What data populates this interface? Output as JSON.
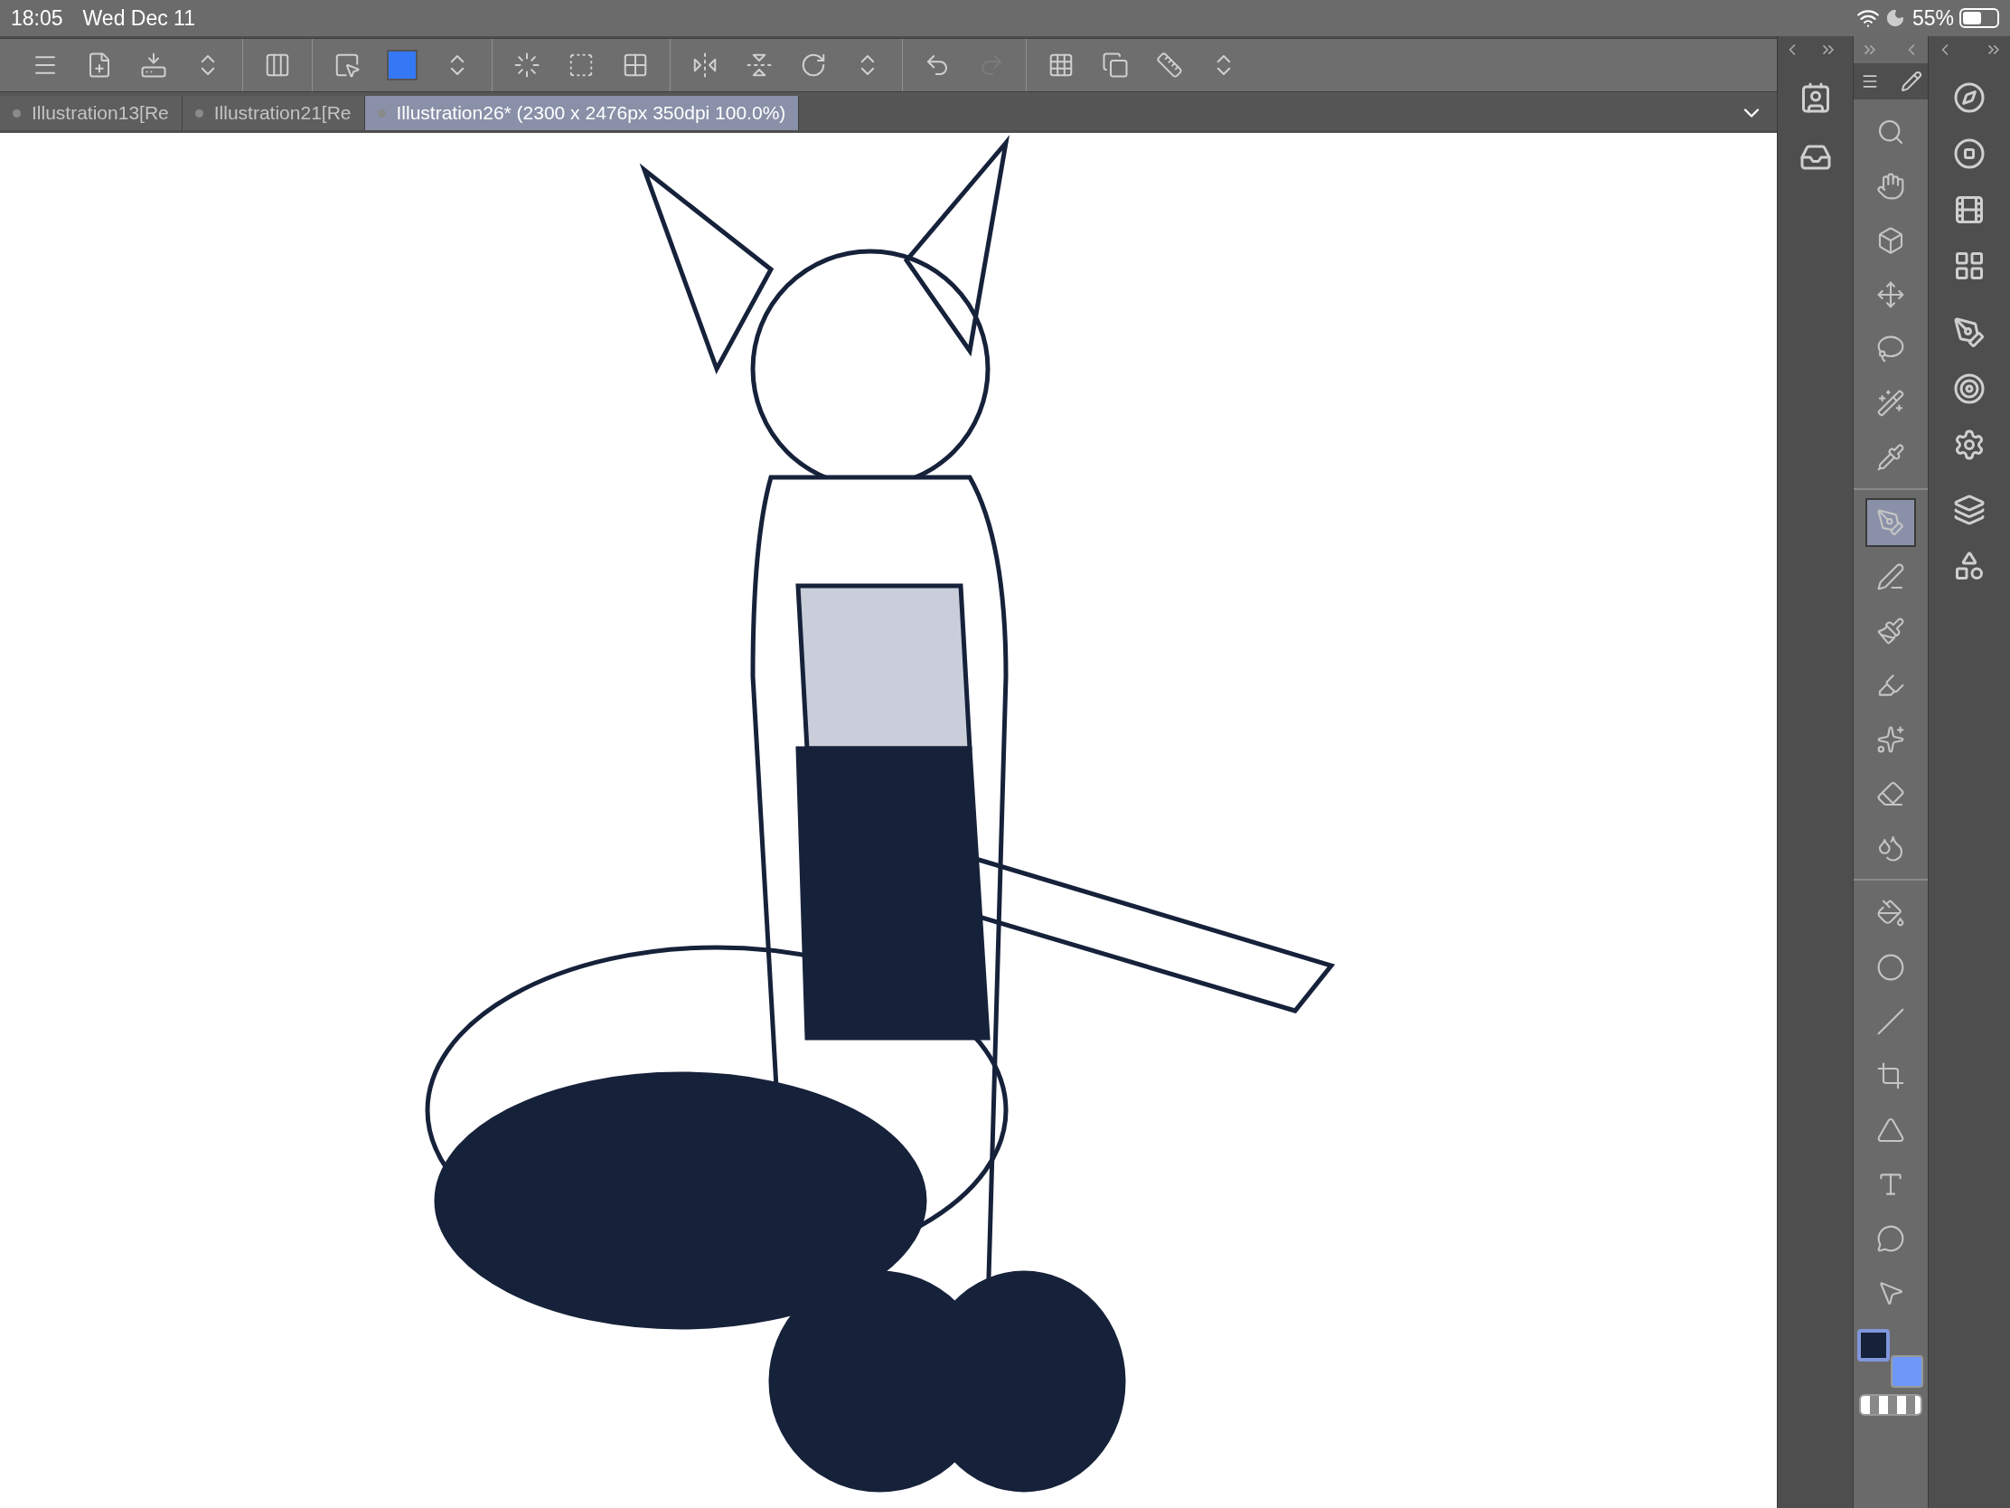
{
  "status_bar": {
    "time": "18:05",
    "date": "Wed Dec 11",
    "battery": "55%"
  },
  "toolbar_groups": [
    [
      {
        "kind": "menu",
        "disabled": false
      },
      {
        "kind": "new-file",
        "disabled": false
      },
      {
        "kind": "export",
        "disabled": false
      },
      {
        "kind": "more",
        "disabled": false
      }
    ],
    [
      {
        "kind": "frame",
        "disabled": false
      }
    ],
    [
      {
        "kind": "selection-pen",
        "disabled": false
      },
      {
        "kind": "swatch",
        "color": "#3478f6"
      },
      {
        "kind": "more",
        "disabled": false
      }
    ],
    [
      {
        "kind": "dotted",
        "disabled": false
      },
      {
        "kind": "transform",
        "disabled": false
      },
      {
        "kind": "mesh",
        "disabled": false
      }
    ],
    [
      {
        "kind": "flip-h",
        "disabled": false
      },
      {
        "kind": "flip-v",
        "disabled": false
      },
      {
        "kind": "rotate",
        "disabled": false
      },
      {
        "kind": "more",
        "disabled": false
      }
    ],
    [
      {
        "kind": "undo",
        "disabled": false
      },
      {
        "kind": "redo",
        "disabled": true
      }
    ],
    [
      {
        "kind": "ruler-add",
        "disabled": false
      },
      {
        "kind": "copy",
        "disabled": false
      },
      {
        "kind": "ruler",
        "disabled": false
      },
      {
        "kind": "more",
        "disabled": false
      }
    ]
  ],
  "tabs": [
    {
      "label": "Illustration13[Re",
      "selected": false
    },
    {
      "label": "Illustration21[Re",
      "selected": false
    },
    {
      "label": "Illustration26* (2300 x 2476px 350dpi 100.0%)",
      "selected": true
    }
  ],
  "tool_groups": [
    [
      {
        "kind": "zoom",
        "selected": false
      },
      {
        "kind": "hand",
        "selected": false
      },
      {
        "kind": "cube",
        "selected": false
      },
      {
        "kind": "move",
        "selected": false
      },
      {
        "kind": "lasso",
        "selected": false
      },
      {
        "kind": "wand",
        "selected": false
      },
      {
        "kind": "eyedropper",
        "selected": false
      }
    ],
    [
      {
        "kind": "pen",
        "selected": true
      },
      {
        "kind": "pencil",
        "selected": false
      },
      {
        "kind": "brush",
        "selected": false
      },
      {
        "kind": "marker",
        "selected": false
      },
      {
        "kind": "sparkle",
        "selected": false
      },
      {
        "kind": "eraser",
        "selected": false
      },
      {
        "kind": "drops",
        "selected": false
      }
    ],
    [
      {
        "kind": "bucket",
        "selected": false
      },
      {
        "kind": "circle",
        "selected": false
      },
      {
        "kind": "line",
        "selected": false
      },
      {
        "kind": "frame-cut",
        "selected": false
      },
      {
        "kind": "ruler-tri",
        "selected": false
      },
      {
        "kind": "text",
        "selected": false
      },
      {
        "kind": "balloon",
        "selected": false
      },
      {
        "kind": "pointer",
        "selected": false
      }
    ]
  ],
  "color_swatches": [
    {
      "color": "#16213a",
      "selected": true
    },
    {
      "color": "#6e98f8",
      "selected": false
    }
  ]
}
